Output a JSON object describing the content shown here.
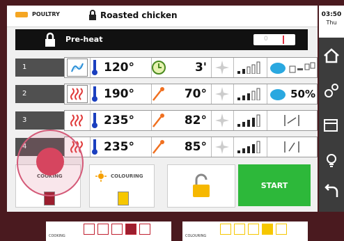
{
  "header": {
    "category": "POULTRY",
    "recipe_title": "Roasted chicken"
  },
  "preheat": {
    "label": "Pre-heat",
    "toggle_off": "0",
    "toggle_on": "I"
  },
  "clock": {
    "time": "03:50",
    "day": "Thu"
  },
  "steps": [
    {
      "num": "1",
      "mode_icon": "steam-icon",
      "temp": "120°",
      "core_icon": "timer-icon",
      "core_value": "3'",
      "humidity_value": "",
      "vent_icon": "vent-open-icon"
    },
    {
      "num": "2",
      "mode_icon": "combi-heat-icon",
      "temp": "190°",
      "core_icon": "probe-icon",
      "core_value": "70°",
      "humidity_value": "50%",
      "vent_icon": ""
    },
    {
      "num": "3",
      "mode_icon": "convection-icon",
      "temp": "235°",
      "core_icon": "probe-icon",
      "core_value": "82°",
      "humidity_value": "",
      "vent_icon": "damper-icon"
    },
    {
      "num": "4",
      "mode_icon": "convection-icon",
      "temp": "235°",
      "core_icon": "probe-icon",
      "core_value": "85°",
      "humidity_value": "",
      "vent_icon": "damper-icon"
    }
  ],
  "bottom": {
    "cooking_label": "COOKING",
    "colouring_label": "COLOURING",
    "start_label": "START"
  },
  "strips": {
    "cooking_label": "COOKING",
    "colouring_label": "COLOURING"
  },
  "colors": {
    "accent_red": "#9b1e2e",
    "start_green": "#2db83a",
    "colouring_yellow": "#f6c700"
  }
}
